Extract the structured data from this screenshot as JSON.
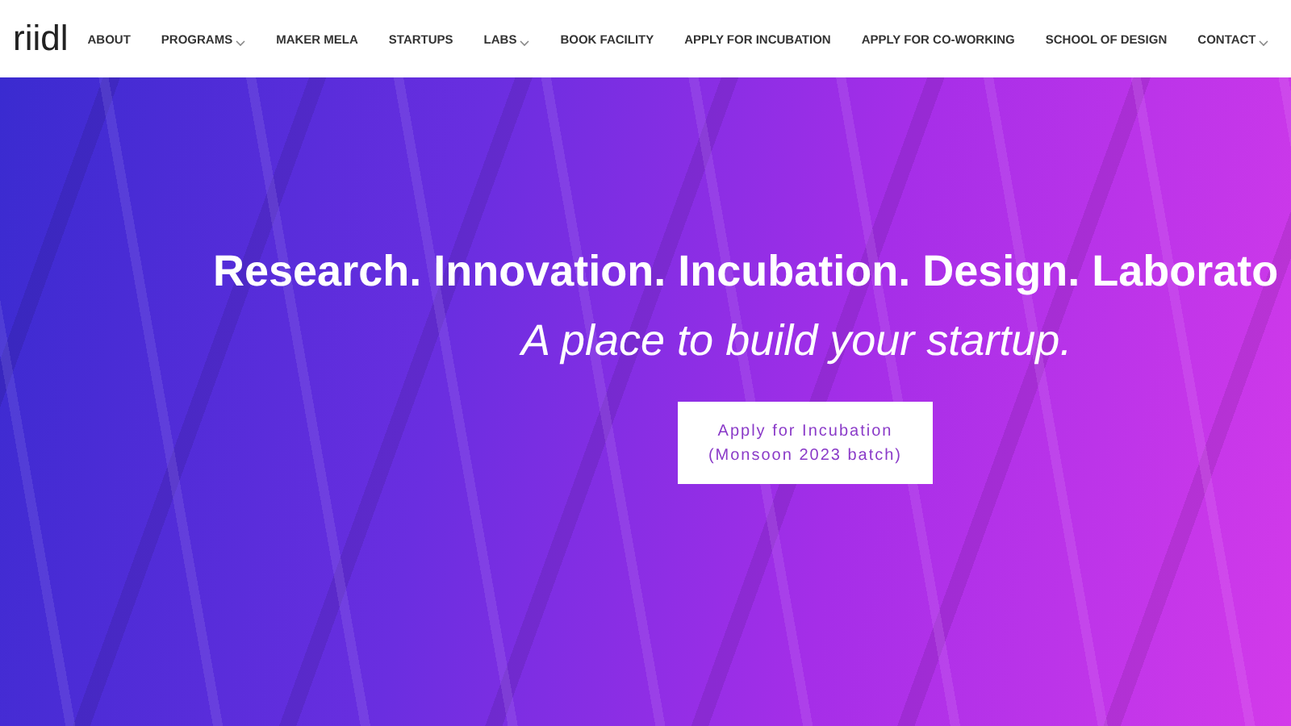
{
  "logo": "riidl",
  "nav": [
    {
      "label": "ABOUT",
      "dropdown": false
    },
    {
      "label": "PROGRAMS",
      "dropdown": true
    },
    {
      "label": "MAKER MELA",
      "dropdown": false
    },
    {
      "label": "STARTUPS",
      "dropdown": false
    },
    {
      "label": "LABS",
      "dropdown": true
    },
    {
      "label": "BOOK FACILITY",
      "dropdown": false
    },
    {
      "label": "APPLY FOR INCUBATION",
      "dropdown": false
    },
    {
      "label": "APPLY FOR CO-WORKING",
      "dropdown": false
    },
    {
      "label": "SCHOOL OF DESIGN",
      "dropdown": false
    },
    {
      "label": "CONTACT",
      "dropdown": true
    }
  ],
  "hero": {
    "headline": "Research. Innovation. Incubation. Design. Laborato",
    "tagline": "A place to build your startup.",
    "cta": [
      "Apply for Incubation",
      "(Monsoon 2023 batch)"
    ]
  }
}
